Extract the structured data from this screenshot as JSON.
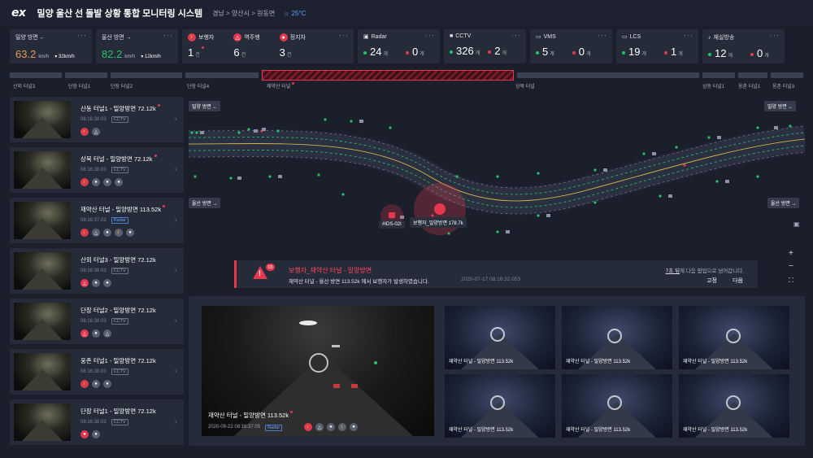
{
  "header": {
    "logo": "ex",
    "title": "밀양 울산 선 돌발 상황 통합 모니터링 시스템",
    "location": "경남 > 양산시 > 원동면",
    "temperature": "25°C"
  },
  "cards": {
    "dir1": {
      "label": "밀양 방면 ←",
      "value": "63.2",
      "unit": "km/h",
      "speed": "32km/h",
      "color": "#e79a4f"
    },
    "dir2": {
      "label": "울산 방면 →",
      "value": "82.2",
      "unit": "km/h",
      "speed": "12km/h",
      "color": "#23c36a"
    },
    "events": [
      {
        "label": "보행자",
        "value": "1",
        "unit": "건"
      },
      {
        "label": "역주행",
        "value": "6",
        "unit": "건"
      },
      {
        "label": "정지차",
        "value": "3",
        "unit": "건"
      }
    ],
    "devices": [
      {
        "label": "Radar",
        "ok": "24",
        "err": "0",
        "unit": "개"
      },
      {
        "label": "CCTV",
        "ok": "326",
        "err": "2",
        "unit": "개"
      },
      {
        "label": "VMS",
        "ok": "5",
        "err": "0",
        "unit": "개"
      },
      {
        "label": "LCS",
        "ok": "19",
        "err": "1",
        "unit": "개"
      },
      {
        "label": "재실방송",
        "ok": "12",
        "err": "0",
        "unit": "개"
      }
    ]
  },
  "tunnels": [
    "산외 터널3",
    "단장 터널1",
    "단장 터널2",
    "단장 터널4",
    "제약산 터널",
    "상북 터널",
    "삼동 터널1",
    "웅촌 터널1",
    "웅촌 터널3"
  ],
  "list": [
    {
      "title": "산동 터널1 - 밀양방면  72.12k",
      "time": "08:16:38.03",
      "tag": "CCTV"
    },
    {
      "title": "상북 터널 - 밀양방면  72.12k",
      "time": "08:16:38.03",
      "tag": "CCTV"
    },
    {
      "title": "재약산 터널 - 밀양방면  113.52k",
      "time": "08:16:37.03",
      "tag": "Radar"
    },
    {
      "title": "산외 터널3 - 밀양방면  72.12k",
      "time": "08:16:38.03",
      "tag": "CCTV"
    },
    {
      "title": "단장 터널2 - 밀양방면  72.12k",
      "time": "08:16:38.03",
      "tag": "CCTV"
    },
    {
      "title": "웅촌 터널1 - 밀양방면  72.12k",
      "time": "08:16:38.03",
      "tag": "CCTV"
    },
    {
      "title": "단장 터널1 - 밀양방면  72.12k",
      "time": "08:16:38.03",
      "tag": "CCTV"
    }
  ],
  "map": {
    "dir_top_left": "밀양 방면 ←",
    "dir_top_right": "밀양 방면 ←",
    "dir_bot_left": "울산 방면 →",
    "dir_bot_right": "울산 방면 →",
    "device_id": "#IDS-02I",
    "event_label": "보행자_밀양방면 178.7k"
  },
  "alert": {
    "badge": "03",
    "title": "보행자_재약산 터널 - 밀양방면",
    "message": "재약산 터널 - 울산 방면 113.52k 에서 보행자가 발생하였습니다.",
    "time": "2020-07-17 08:16:32.053",
    "countdown_link": "7초 뒤",
    "countdown_rest": "에 다음 팝업으로 넘어갑니다.",
    "fix": "고정",
    "next": "다음"
  },
  "video": {
    "main_label": "재약산 터널 - 밀양방면 113.52k",
    "main_time": "2020-09-22 08:16:37.05",
    "main_tag": "Radar",
    "sub_label": "재약산 터널 - 밀양방면 113.52k"
  }
}
